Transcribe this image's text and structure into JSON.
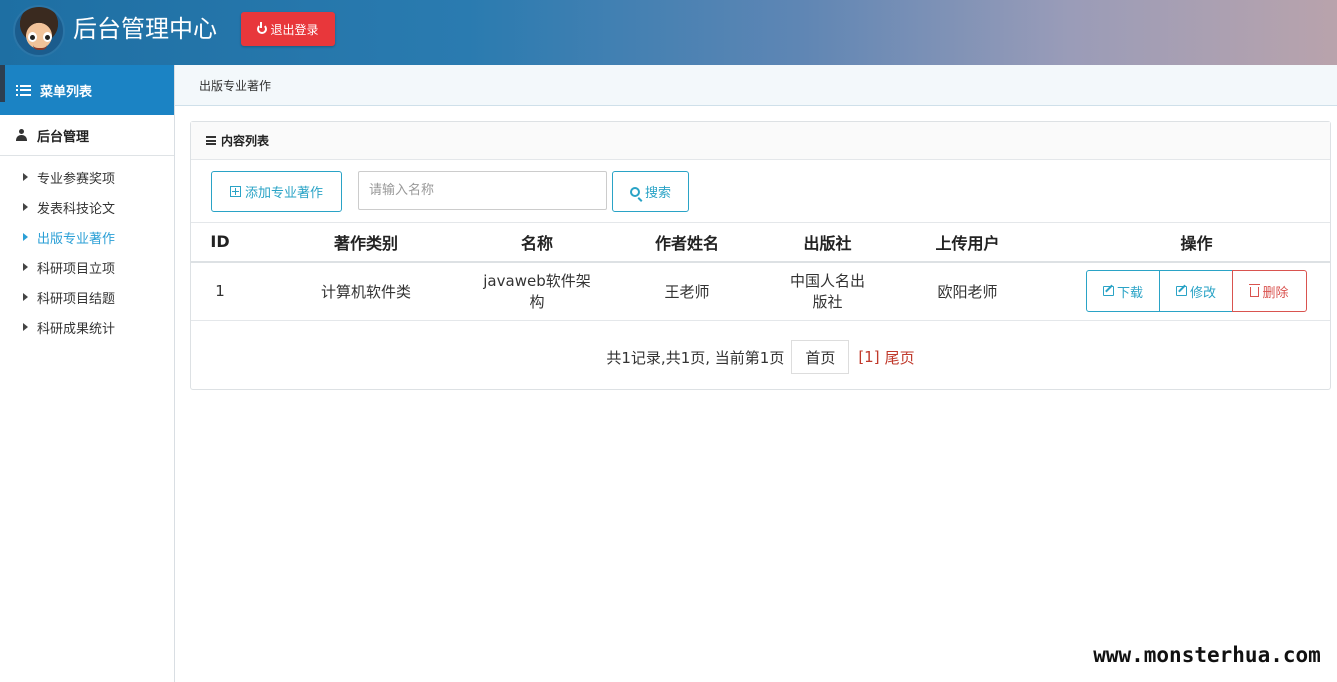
{
  "header": {
    "title": "后台管理中心",
    "logout_label": "退出登录"
  },
  "sidebar": {
    "heading": "菜单列表",
    "group": "后台管理",
    "items": [
      {
        "label": "专业参赛奖项",
        "active": false
      },
      {
        "label": "发表科技论文",
        "active": false
      },
      {
        "label": "出版专业著作",
        "active": true
      },
      {
        "label": "科研项目立项",
        "active": false
      },
      {
        "label": "科研项目结题",
        "active": false
      },
      {
        "label": "科研成果统计",
        "active": false
      }
    ]
  },
  "breadcrumb": "出版专业著作",
  "panel": {
    "title": "内容列表",
    "add_label": "添加专业著作",
    "search_placeholder": "请输入名称",
    "search_label": "搜索"
  },
  "table": {
    "columns": [
      "ID",
      "著作类别",
      "名称",
      "作者姓名",
      "出版社",
      "上传用户",
      "操作"
    ],
    "rows": [
      {
        "id": "1",
        "category": "计算机软件类",
        "name": "javaweb软件架构",
        "author": "王老师",
        "publisher": "中国人名出版社",
        "uploader": "欧阳老师"
      }
    ],
    "actions": {
      "download": "下载",
      "edit": "修改",
      "delete": "删除"
    }
  },
  "pagination": {
    "summary": "共1记录,共1页, 当前第1页",
    "first": "首页",
    "current": "[1]",
    "last": "尾页"
  },
  "watermark": "www.monsterhua.com",
  "colors": {
    "accent": "#2aa3c6",
    "sidebar_header": "#1b83c4",
    "danger": "#e8373b",
    "active_menu": "#2a9fd6"
  }
}
